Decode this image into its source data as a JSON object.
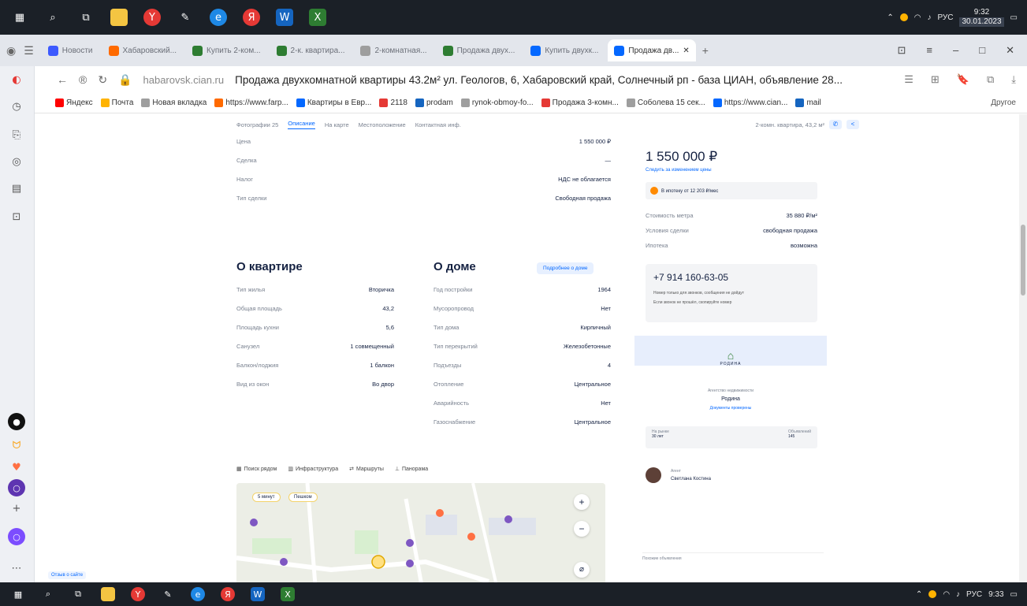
{
  "taskbar": {
    "time": "9:32",
    "date": "30.01.2023",
    "lang": "РУС",
    "time_bottom": "9:33"
  },
  "tabs": [
    {
      "label": "Новости",
      "color": "#3d5afe"
    },
    {
      "label": "Хабаровский...",
      "color": "#ff6a00"
    },
    {
      "label": "Купить 2-ком...",
      "color": "#2e7d32"
    },
    {
      "label": "2-к. квартира...",
      "color": "#2e7d32"
    },
    {
      "label": "2-комнатная...",
      "color": "#9e9e9e"
    },
    {
      "label": "Продажа двух...",
      "color": "#2e7d32"
    },
    {
      "label": "Купить двухк...",
      "color": "#0468ff"
    },
    {
      "label": "Продажа дв...",
      "color": "#0468ff"
    }
  ],
  "address": {
    "domain": "habarovsk.cian.ru",
    "title": "Продажа двухкомнатной квартиры 43.2м² ул. Геологов, 6, Хабаровский край, Солнечный рп - база ЦИАН, объявление 28..."
  },
  "bookmarks": [
    {
      "label": "Яндекс",
      "color": "#ff0000"
    },
    {
      "label": "Почта",
      "color": "#ffb300"
    },
    {
      "label": "Новая вкладка",
      "color": "#9e9e9e"
    },
    {
      "label": "https://www.farp...",
      "color": "#ff6a00"
    },
    {
      "label": "Квартиры в Евр...",
      "color": "#0468ff"
    },
    {
      "label": "2118",
      "color": "#e53935"
    },
    {
      "label": "prodam",
      "color": "#1565c0"
    },
    {
      "label": "rynok-obmoy-fo...",
      "color": "#9e9e9e"
    },
    {
      "label": "Продажа 3-комн...",
      "color": "#e53935"
    },
    {
      "label": "Соболева 15 сек...",
      "color": "#9e9e9e"
    },
    {
      "label": "https://www.cian...",
      "color": "#0468ff"
    },
    {
      "label": "mail",
      "color": "#1565c0"
    }
  ],
  "bookmarks_other": "Другое",
  "subnav": {
    "items": [
      "Фотографии 25",
      "Описание",
      "На карте",
      "Местоположение",
      "Контактная инф."
    ],
    "active_index": 1,
    "right": "2-комн. квартира, 43,2 м²"
  },
  "price_rows": [
    {
      "label": "Цена",
      "value": "1 550 000 ₽"
    },
    {
      "label": "Сделка",
      "value": "—"
    },
    {
      "label": "Налог",
      "value": "НДС не облагается"
    },
    {
      "label": "Тип сделки",
      "value": "Свободная продажа"
    }
  ],
  "flat": {
    "title": "О квартире",
    "rows": [
      {
        "label": "Тип жилья",
        "value": "Вторичка"
      },
      {
        "label": "Общая площадь",
        "value": "43,2"
      },
      {
        "label": "Площадь кухни",
        "value": "5,6"
      },
      {
        "label": "Санузел",
        "value": "1 совмещенный"
      },
      {
        "label": "Балкон/лоджия",
        "value": "1 балкон"
      },
      {
        "label": "Вид из окон",
        "value": "Во двор"
      }
    ]
  },
  "house": {
    "title": "О доме",
    "pill": "Подробнее о доме",
    "rows": [
      {
        "label": "Год постройки",
        "value": "1964"
      },
      {
        "label": "Мусоропровод",
        "value": "Нет"
      },
      {
        "label": "Тип дома",
        "value": "Кирпичный"
      },
      {
        "label": "Тип перекрытий",
        "value": "Железобетонные"
      },
      {
        "label": "Подъезды",
        "value": "4"
      },
      {
        "label": "Отопление",
        "value": "Центральное"
      },
      {
        "label": "Аварийность",
        "value": "Нет"
      },
      {
        "label": "Газоснабжение",
        "value": "Центральное"
      }
    ]
  },
  "map_tabs": [
    "Поиск рядом",
    "Инфраструктура",
    "Маршруты",
    "Панорама"
  ],
  "map": {
    "chip1": "5 минут",
    "chip2": "Пешком"
  },
  "side": {
    "price": "1 550 000 ₽",
    "price_link": "Следить за изменением цены",
    "mortgage": "В ипотеку от 12 203 ₽/мес",
    "rows": [
      {
        "label": "Стоимость метра",
        "value": "35 880 ₽/м²"
      },
      {
        "label": "Условия сделки",
        "value": "свободная продажа"
      },
      {
        "label": "Ипотека",
        "value": "возможна"
      }
    ],
    "phone": "+7 914 160-63-05",
    "phone_note1": "Номер только для звонков, сообщения не дойдут",
    "phone_note2": "Если звонок не прошёл, скопируйте номер",
    "agency_logo": "РОДИНА",
    "agency_caption": "Агентство недвижимости",
    "agency_name": "Родина",
    "agency_docs": "Документы проверены",
    "agency_stats": [
      {
        "label": "На рынке",
        "value": "30 лет"
      },
      {
        "label": "Объявлений",
        "value": "145"
      }
    ],
    "agent_caption": "Агент",
    "agent_name": "Светлана Костина",
    "bottom_note": "Похожие объявления"
  },
  "footer_note": "Отзыв о сайте"
}
